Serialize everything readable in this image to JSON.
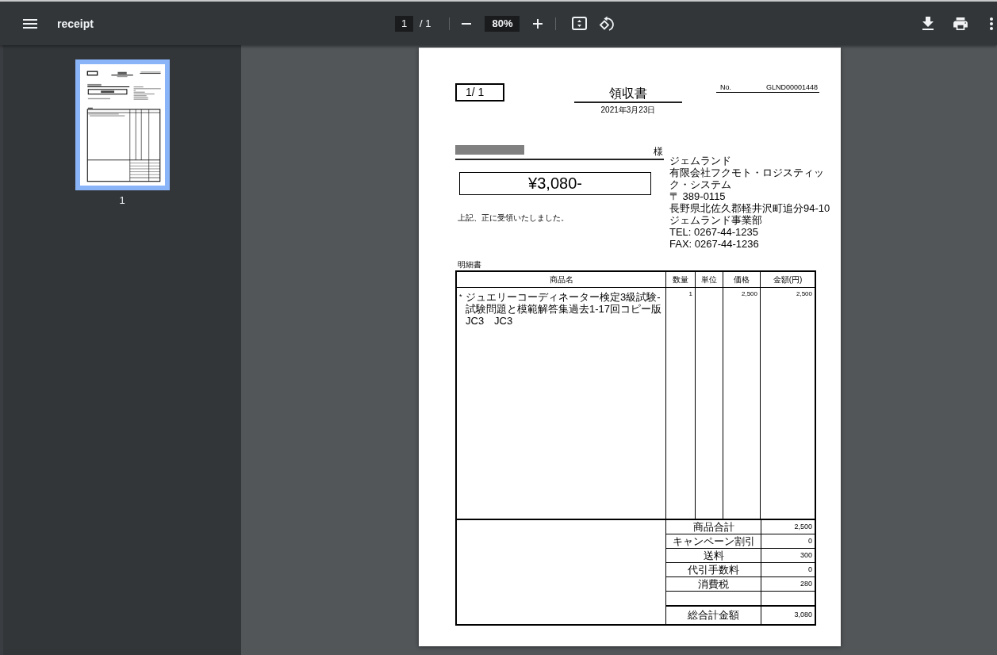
{
  "toolbar": {
    "title": "receipt",
    "page": {
      "value": "1",
      "total": "/ 1"
    },
    "zoom": {
      "value": "80%"
    }
  },
  "sidebar": {
    "thumbnails": [
      {
        "label": "1",
        "selected": true
      }
    ]
  },
  "document": {
    "page_counter": "1/ 1",
    "title": "領収書",
    "date": "2021年3月23日",
    "number": {
      "label": "No.",
      "value": "GLND00001448"
    },
    "recipient": {
      "redacted": true,
      "honorific": "様"
    },
    "amount": "¥3,080-",
    "acknowledgement": "上記、正に受領いたしました。",
    "issuer_lines": [
      "ジェムランド",
      "有限会社フクモト・ロジスティック・システム",
      "〒 389-0115",
      "長野県北佐久郡軽井沢町追分94-10",
      "ジェムランド事業部",
      "TEL: 0267-44-1235",
      "FAX: 0267-44-1236"
    ],
    "details": {
      "title": "明細書",
      "columns": [
        "商品名",
        "数量",
        "単位",
        "価格",
        "金額(円)"
      ],
      "rows": [
        {
          "marker": "*",
          "name": "ジュエリーコーディネーター検定3級試験-\n試験問題と模範解答集過去1-17回コピー版 JC3　JC3",
          "quantity": "1",
          "price": "2,500",
          "amount": "2,500"
        }
      ],
      "totals": [
        {
          "kind": "line",
          "label": "商品合計",
          "value": "2,500"
        },
        {
          "kind": "line",
          "label": "キャンペーン割引",
          "value": "0"
        },
        {
          "kind": "line",
          "label": "送料",
          "value": "300"
        },
        {
          "kind": "line",
          "label": "代引手数料",
          "value": "0"
        },
        {
          "kind": "line",
          "label": "消費税",
          "value": "280"
        },
        {
          "kind": "blank"
        },
        {
          "kind": "grand",
          "label": "総合計金額",
          "value": "3,080"
        }
      ]
    }
  }
}
